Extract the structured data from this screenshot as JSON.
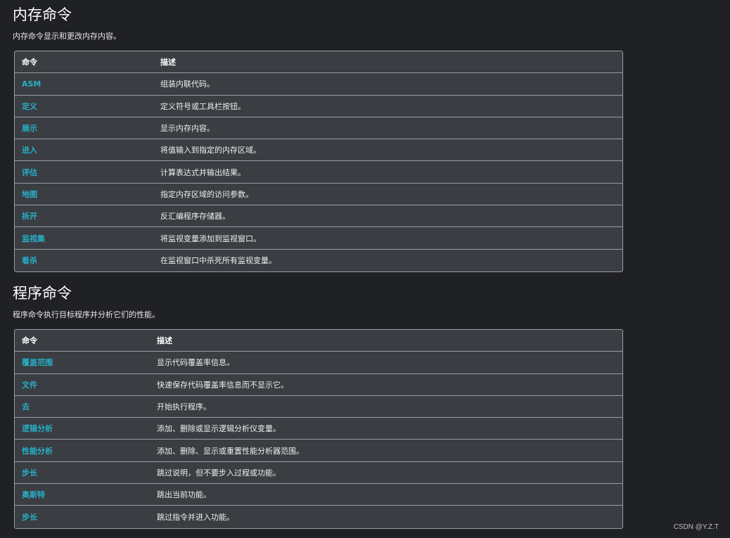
{
  "memory": {
    "title": "内存命令",
    "description": "内存命令显示和更改内存内容。",
    "headers": {
      "command": "命令",
      "description": "描述"
    },
    "rows": [
      {
        "command": "ASM",
        "description": "组装内联代码。"
      },
      {
        "command": "定义",
        "description": "定义符号或工具栏按钮。"
      },
      {
        "command": "展示",
        "description": "显示内存内容。"
      },
      {
        "command": "进入",
        "description": "将值输入到指定的内存区域。"
      },
      {
        "command": "评估",
        "description": "计算表达式并输出结果。"
      },
      {
        "command": "地图",
        "description": "指定内存区域的访问参数。"
      },
      {
        "command": "拆开",
        "description": "反汇编程序存储器。"
      },
      {
        "command": "监视集",
        "description": "将监视变量添加到监视窗口。"
      },
      {
        "command": "看杀",
        "description": "在监视窗口中杀死所有监视变量。"
      }
    ]
  },
  "program": {
    "title": "程序命令",
    "description": "程序命令执行目标程序并分析它们的性能。",
    "headers": {
      "command": "命令",
      "description": "描述"
    },
    "rows": [
      {
        "command": "覆盖范围",
        "description": "显示代码覆盖率信息。"
      },
      {
        "command": "文件",
        "description": "快速保存代码覆盖率信息而不显示它。"
      },
      {
        "command": "去",
        "description": "开始执行程序。"
      },
      {
        "command": "逻辑分析",
        "description": "添加、删除或显示逻辑分析仪变量。"
      },
      {
        "command": "性能分析",
        "description": "添加、删除、显示或重置性能分析器范围。"
      },
      {
        "command": "步长",
        "description": "跳过说明，但不要步入过程或功能。"
      },
      {
        "command": "奥斯特",
        "description": "跳出当前功能。"
      },
      {
        "command": "步长",
        "description": "跳过指令并进入功能。"
      }
    ]
  },
  "watermark": "CSDN @Y.Z.T"
}
